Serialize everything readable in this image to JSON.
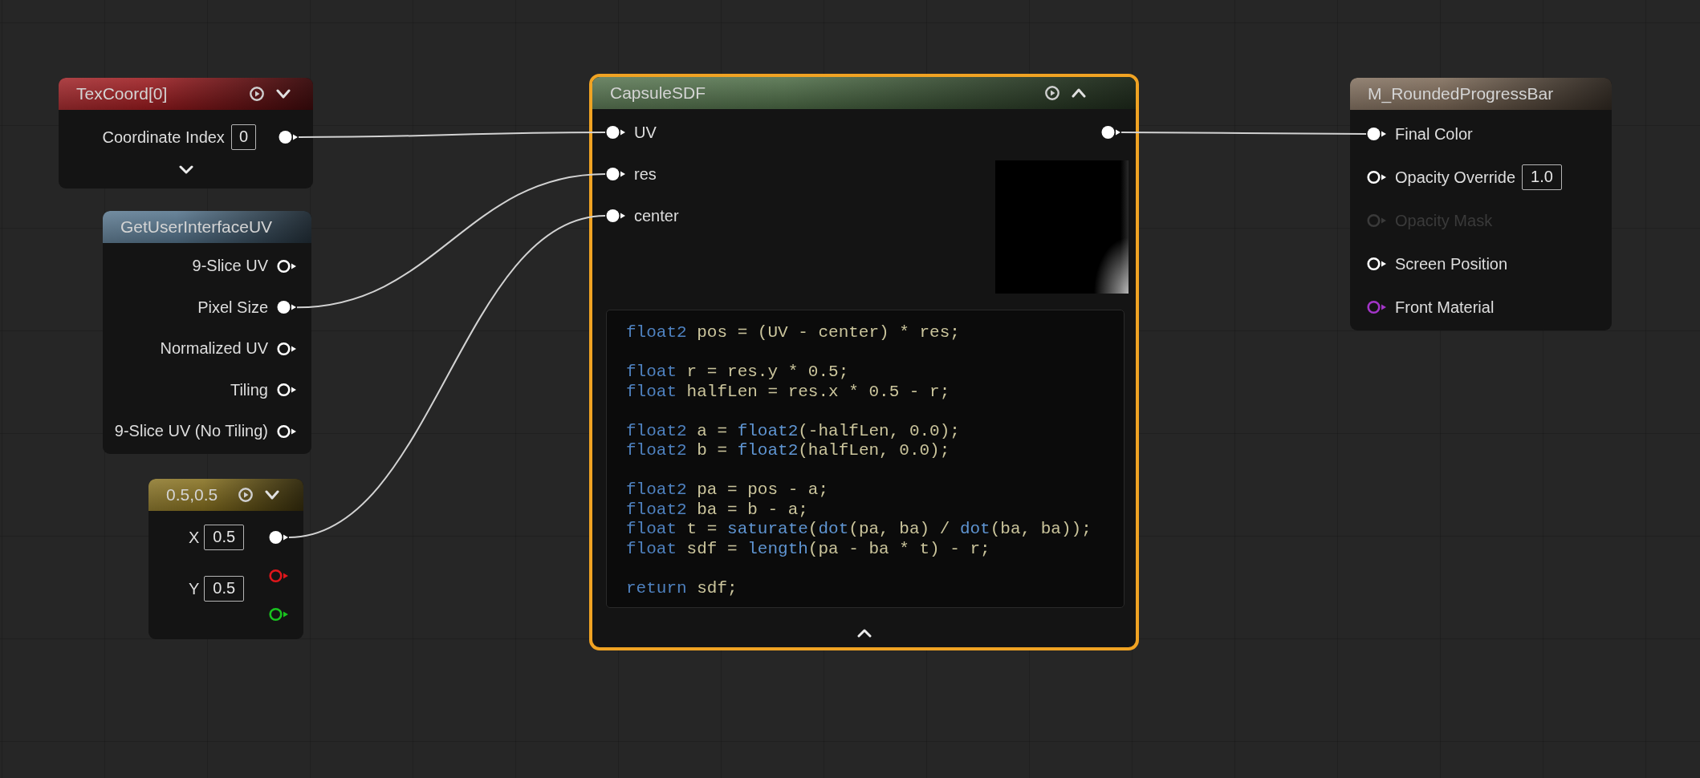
{
  "graph": {
    "nodes": [
      {
        "kind": "texcoord",
        "title": "TexCoord[0]",
        "color": "#9c1b1f",
        "selected": false,
        "expanded": false,
        "outputs": [
          {
            "label": "Coordinate Index",
            "value": "0",
            "connected": true,
            "color": "#ffffff"
          }
        ],
        "advanced": {
          "expanded": false
        }
      },
      {
        "kind": "function",
        "title": "GetUserInterfaceUV",
        "color": "#56758d",
        "selected": false,
        "outputs": [
          {
            "label": "9-Slice UV",
            "connected": false,
            "color": "#ffffff"
          },
          {
            "label": "Pixel Size",
            "connected": true,
            "color": "#ffffff"
          },
          {
            "label": "Normalized UV",
            "connected": false,
            "color": "#ffffff"
          },
          {
            "label": "Tiling",
            "connected": false,
            "color": "#ffffff"
          },
          {
            "label": "9-Slice UV (No Tiling)",
            "connected": false,
            "color": "#ffffff"
          }
        ]
      },
      {
        "kind": "constant",
        "title": "0.5,0.5",
        "color": "#86701f",
        "selected": false,
        "expanded": false,
        "fields": [
          {
            "label": "X",
            "value": "0.5"
          },
          {
            "label": "Y",
            "value": "0.5"
          }
        ],
        "outputs": [
          {
            "connected": true,
            "color": "#ffffff"
          },
          {
            "connected": false,
            "color": "#e0161b"
          },
          {
            "connected": false,
            "color": "#19c31f"
          }
        ]
      },
      {
        "kind": "custom",
        "title": "CapsuleSDF",
        "color": "#4f6e48",
        "selected": true,
        "expanded": true,
        "inputs": [
          {
            "label": "UV",
            "connected": true,
            "color": "#ffffff"
          },
          {
            "label": "res",
            "connected": true,
            "color": "#ffffff"
          },
          {
            "label": "center",
            "connected": true,
            "color": "#ffffff"
          }
        ],
        "outputs": [
          {
            "connected": true,
            "color": "#ffffff"
          }
        ],
        "preview": true,
        "code": [
          {
            "lines": [
              [
                {
                  "kind": "keyword",
                  "text": "float2"
                },
                {
                  "kind": "plain",
                  "text": " pos = (UV - center) * res;"
                }
              ]
            ]
          },
          {
            "lines": [
              [
                {
                  "kind": "keyword",
                  "text": "float"
                },
                {
                  "kind": "plain",
                  "text": " r = res.y * 0.5;"
                }
              ],
              [
                {
                  "kind": "keyword",
                  "text": "float"
                },
                {
                  "kind": "plain",
                  "text": " halfLen = res.x * 0.5 - r;"
                }
              ]
            ]
          },
          {
            "lines": [
              [
                {
                  "kind": "keyword",
                  "text": "float2"
                },
                {
                  "kind": "plain",
                  "text": " a = "
                },
                {
                  "kind": "function",
                  "text": "float2"
                },
                {
                  "kind": "plain",
                  "text": "(-halfLen, 0.0);"
                }
              ],
              [
                {
                  "kind": "keyword",
                  "text": "float2"
                },
                {
                  "kind": "plain",
                  "text": " b = "
                },
                {
                  "kind": "function",
                  "text": "float2"
                },
                {
                  "kind": "plain",
                  "text": "(halfLen, 0.0);"
                }
              ]
            ]
          },
          {
            "lines": [
              [
                {
                  "kind": "keyword",
                  "text": "float2"
                },
                {
                  "kind": "plain",
                  "text": " pa = pos - a;"
                }
              ],
              [
                {
                  "kind": "keyword",
                  "text": "float2"
                },
                {
                  "kind": "plain",
                  "text": " ba = b - a;"
                }
              ],
              [
                {
                  "kind": "keyword",
                  "text": "float"
                },
                {
                  "kind": "plain",
                  "text": " t = "
                },
                {
                  "kind": "function",
                  "text": "saturate"
                },
                {
                  "kind": "plain",
                  "text": "("
                },
                {
                  "kind": "function",
                  "text": "dot"
                },
                {
                  "kind": "plain",
                  "text": "(pa, ba) / "
                },
                {
                  "kind": "function",
                  "text": "dot"
                },
                {
                  "kind": "plain",
                  "text": "(ba, ba));"
                }
              ],
              [
                {
                  "kind": "keyword",
                  "text": "float"
                },
                {
                  "kind": "plain",
                  "text": " sdf = "
                },
                {
                  "kind": "function",
                  "text": "length"
                },
                {
                  "kind": "plain",
                  "text": "(pa - ba * t) - r;"
                }
              ]
            ]
          },
          {
            "lines": [
              [
                {
                  "kind": "keyword",
                  "text": "return"
                },
                {
                  "kind": "plain",
                  "text": " sdf;"
                }
              ]
            ]
          }
        ],
        "advanced": {
          "expanded": true
        }
      },
      {
        "kind": "material",
        "title": "M_RoundedProgressBar",
        "color": "#7d6a58",
        "selected": false,
        "inputs": [
          {
            "label": "Final Color",
            "connected": true,
            "disabled": false,
            "color": "#ffffff"
          },
          {
            "label": "Opacity Override",
            "value": "1.0",
            "connected": false,
            "disabled": false,
            "color": "#ffffff"
          },
          {
            "label": "Opacity Mask",
            "connected": false,
            "disabled": true,
            "color": "#3a3a3a"
          },
          {
            "label": "Screen Position",
            "connected": false,
            "disabled": false,
            "color": "#ffffff"
          },
          {
            "label": "Front Material",
            "connected": false,
            "disabled": false,
            "color": "#a335c8"
          }
        ]
      }
    ]
  }
}
